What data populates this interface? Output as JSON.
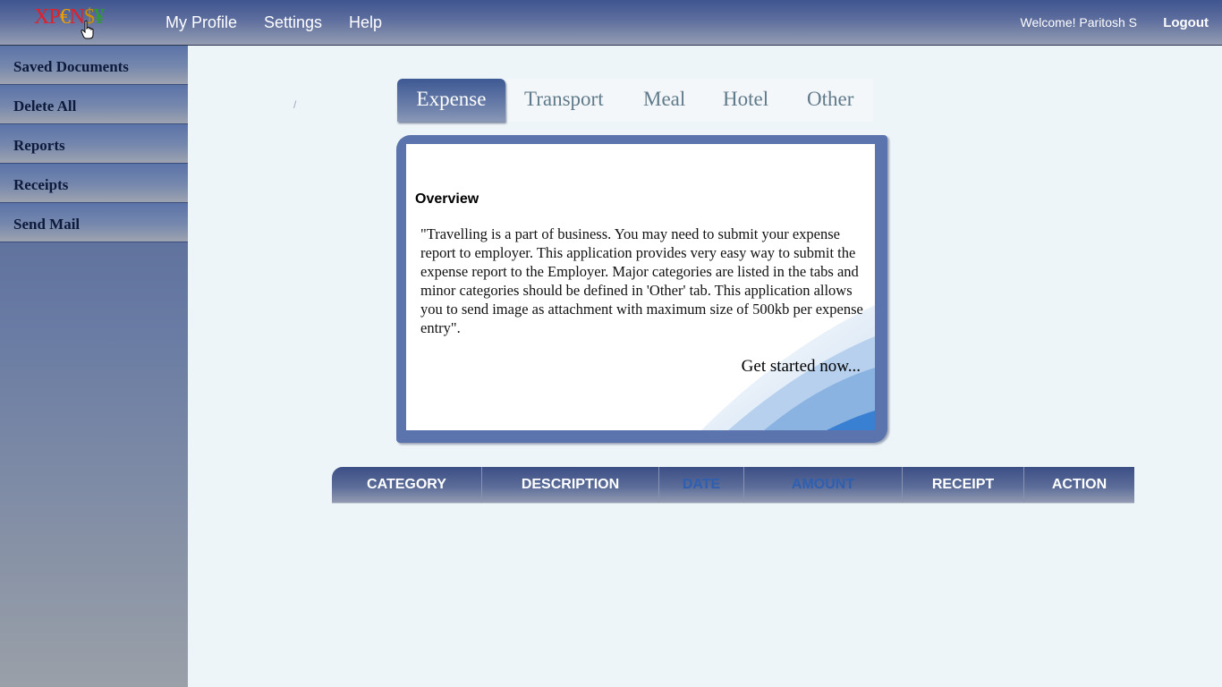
{
  "header": {
    "logo_letters": [
      "X",
      "P",
      "€",
      "N",
      "$",
      "¥"
    ],
    "nav": [
      "My Profile",
      "Settings",
      "Help"
    ],
    "welcome": "Welcome! Paritosh S",
    "logout": "Logout"
  },
  "sidebar": {
    "items": [
      "Saved Documents",
      "Delete All",
      "Reports",
      "Receipts",
      "Send Mail"
    ]
  },
  "breadcrumb_separator": "/",
  "tabs": {
    "items": [
      "Expense",
      "Transport",
      "Meal",
      "Hotel",
      "Other"
    ],
    "active": "Expense"
  },
  "overview": {
    "title": "Overview",
    "text": "\"Travelling is a part of business. You may need to submit your expense report to employer. This application provides very easy way to submit the expense report to the Employer. Major categories are listed in the tabs and minor categories should be defined in 'Other' tab. This application allows you to send image as attachment with maximum size of 500kb per expense entry\".",
    "cta": "Get started now..."
  },
  "table": {
    "columns": [
      "CATEGORY",
      "DESCRIPTION",
      "DATE",
      "AMOUNT",
      "RECEIPT",
      "ACTION"
    ]
  },
  "colors": {
    "header_bg": "#3f5590",
    "sidebar_bg": "#4b5f90",
    "card_border": "#5c74ad",
    "page_bg": "#eef5f9"
  }
}
